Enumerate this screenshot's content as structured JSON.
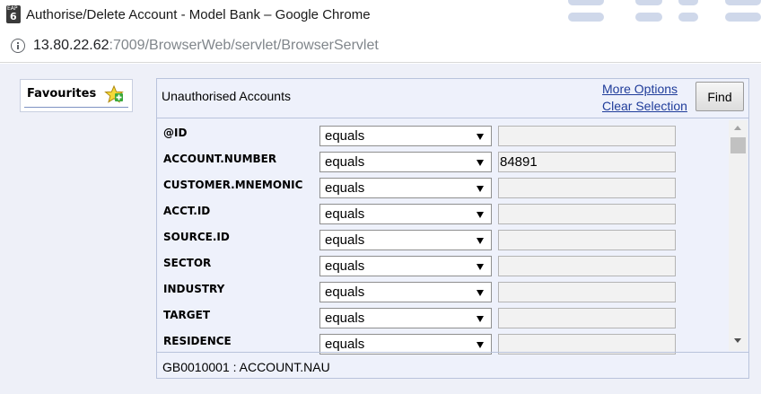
{
  "window": {
    "title": "Authorise/Delete Account - Model Bank – Google Chrome",
    "app_icon_line1": "EAP",
    "app_icon_line2": "6"
  },
  "address_bar": {
    "url_host": "13.80.22.62",
    "url_rest": ":7009/BrowserWeb/servlet/BrowserServlet"
  },
  "favourites": {
    "label": "Favourites"
  },
  "panel": {
    "title": "Unauthorised Accounts",
    "more_options": "More Options",
    "clear_selection": "Clear Selection",
    "find_label": "Find"
  },
  "criteria": [
    {
      "field": "@ID",
      "operator": "equals",
      "value": ""
    },
    {
      "field": "ACCOUNT.NUMBER",
      "operator": "equals",
      "value": "84891"
    },
    {
      "field": "CUSTOMER.MNEMONIC",
      "operator": "equals",
      "value": ""
    },
    {
      "field": "ACCT.ID",
      "operator": "equals",
      "value": ""
    },
    {
      "field": "SOURCE.ID",
      "operator": "equals",
      "value": ""
    },
    {
      "field": "SECTOR",
      "operator": "equals",
      "value": ""
    },
    {
      "field": "INDUSTRY",
      "operator": "equals",
      "value": ""
    },
    {
      "field": "TARGET",
      "operator": "equals",
      "value": ""
    },
    {
      "field": "RESIDENCE",
      "operator": "equals",
      "value": ""
    }
  ],
  "footer": {
    "text": "GB0010001 : ACCOUNT.NAU"
  },
  "colors": {
    "link": "#1f3c9a",
    "panel_bg": "#eef1fb",
    "page_bg": "#eef0f8"
  }
}
